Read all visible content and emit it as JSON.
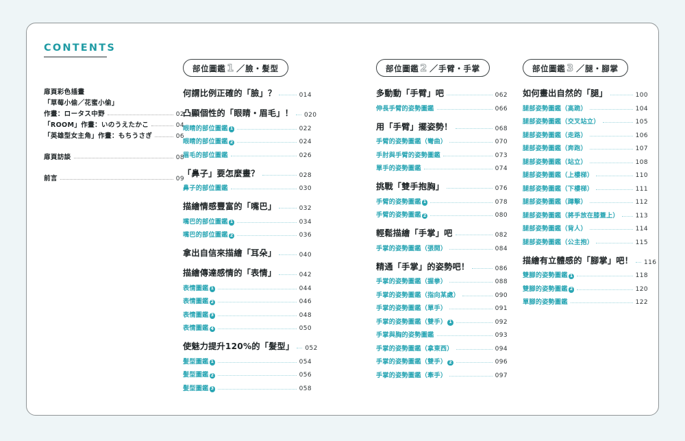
{
  "header": {
    "contents_label": "CONTENTS"
  },
  "front_matter": {
    "items": [
      {
        "label": "扉頁彩色插畫",
        "page": "",
        "dots": false
      },
      {
        "label": "「草莓小偷／花蜜小偷」",
        "page": "",
        "dots": false
      },
      {
        "label": "作畫：ロータス中野",
        "page": "02",
        "dots": true
      },
      {
        "label": "「ROOM」作畫：いのうえたかこ",
        "page": "04",
        "dots": true
      },
      {
        "label": "「英雄型女主角」作畫：もちうさぎ",
        "page": "06",
        "dots": true
      },
      {
        "label": "扉頁訪談",
        "page": "08",
        "dots": true,
        "gap": true
      },
      {
        "label": "前言",
        "page": "09",
        "dots": true,
        "gap": true
      }
    ]
  },
  "sections": [
    {
      "pill_prefix": "部位圖鑑",
      "pill_number": "1",
      "pill_slash": "／",
      "pill_suffix": "臉・髮型",
      "entries": [
        {
          "type": "main",
          "label": "何謂比例正確的「臉」？",
          "page": "014"
        },
        {
          "type": "main",
          "label": "凸顯個性的「眼睛・眉毛」！",
          "page": "020"
        },
        {
          "type": "sub",
          "label": "眼睛的部位圖鑑",
          "badge": "1",
          "page": "022"
        },
        {
          "type": "sub",
          "label": "眼睛的部位圖鑑",
          "badge": "2",
          "page": "024"
        },
        {
          "type": "sub",
          "label": "眉毛的部位圖鑑",
          "badge": "",
          "page": "026"
        },
        {
          "type": "main",
          "label": "「鼻子」要怎麼畫？",
          "page": "028"
        },
        {
          "type": "sub",
          "label": "鼻子的部位圖鑑",
          "badge": "",
          "page": "030"
        },
        {
          "type": "main",
          "label": "描繪情感豐富的「嘴巴」",
          "page": "032"
        },
        {
          "type": "sub",
          "label": "嘴巴的部位圖鑑",
          "badge": "1",
          "page": "034"
        },
        {
          "type": "sub",
          "label": "嘴巴的部位圖鑑",
          "badge": "2",
          "page": "036"
        },
        {
          "type": "main",
          "label": "拿出自信來描繪「耳朵」",
          "page": "040"
        },
        {
          "type": "main",
          "label": "描繪傳達感情的「表情」",
          "page": "042"
        },
        {
          "type": "sub",
          "label": "表情圖鑑",
          "badge": "1",
          "page": "044"
        },
        {
          "type": "sub",
          "label": "表情圖鑑",
          "badge": "2",
          "page": "046"
        },
        {
          "type": "sub",
          "label": "表情圖鑑",
          "badge": "3",
          "page": "048"
        },
        {
          "type": "sub",
          "label": "表情圖鑑",
          "badge": "4",
          "page": "050"
        },
        {
          "type": "main",
          "label": "使魅力提升120%的「髮型」",
          "page": "052"
        },
        {
          "type": "sub",
          "label": "髮型圖鑑",
          "badge": "1",
          "page": "054"
        },
        {
          "type": "sub",
          "label": "髮型圖鑑",
          "badge": "2",
          "page": "056"
        },
        {
          "type": "sub",
          "label": "髮型圖鑑",
          "badge": "3",
          "page": "058"
        }
      ]
    },
    {
      "pill_prefix": "部位圖鑑",
      "pill_number": "2",
      "pill_slash": "／",
      "pill_suffix": "手臂・手掌",
      "entries": [
        {
          "type": "main",
          "label": "多動動「手臂」吧",
          "page": "062"
        },
        {
          "type": "sub",
          "label": "伸長手臂的姿勢圖鑑",
          "badge": "",
          "page": "066"
        },
        {
          "type": "main",
          "label": "用「手臂」擺姿勢！",
          "page": "068"
        },
        {
          "type": "sub",
          "label": "手臂的姿勢圖鑑（彎曲）",
          "badge": "",
          "page": "070"
        },
        {
          "type": "sub",
          "label": "手肘與手臂的姿勢圖鑑",
          "badge": "",
          "page": "073"
        },
        {
          "type": "sub",
          "label": "單手的姿勢圖鑑",
          "badge": "",
          "page": "074"
        },
        {
          "type": "main",
          "label": "挑戰「雙手抱胸」",
          "page": "076"
        },
        {
          "type": "sub",
          "label": "手臂的姿勢圖鑑",
          "badge": "1",
          "page": "078"
        },
        {
          "type": "sub",
          "label": "手臂的姿勢圖鑑",
          "badge": "2",
          "page": "080"
        },
        {
          "type": "main",
          "label": "輕鬆描繪「手掌」吧",
          "page": "082"
        },
        {
          "type": "sub",
          "label": "手掌的姿勢圖鑑（張開）",
          "badge": "",
          "page": "084"
        },
        {
          "type": "main",
          "label": "精通「手掌」的姿勢吧！",
          "page": "086"
        },
        {
          "type": "sub",
          "label": "手掌的姿勢圖鑑（握拳）",
          "badge": "",
          "page": "088"
        },
        {
          "type": "sub",
          "label": "手掌的姿勢圖鑑（指向某處）",
          "badge": "",
          "page": "090"
        },
        {
          "type": "sub",
          "label": "手掌的姿勢圖鑑（單手）",
          "badge": "",
          "page": "091"
        },
        {
          "type": "sub",
          "label": "手掌的姿勢圖鑑（雙手）",
          "badge": "1",
          "page": "092"
        },
        {
          "type": "sub",
          "label": "手掌與胸的姿勢圖鑑",
          "badge": "",
          "page": "093"
        },
        {
          "type": "sub",
          "label": "手掌的姿勢圖鑑（拿東西）",
          "badge": "",
          "page": "094"
        },
        {
          "type": "sub",
          "label": "手掌的姿勢圖鑑（雙手）",
          "badge": "2",
          "page": "096"
        },
        {
          "type": "sub",
          "label": "手掌的姿勢圖鑑（牽手）",
          "badge": "",
          "page": "097"
        }
      ]
    },
    {
      "pill_prefix": "部位圖鑑",
      "pill_number": "3",
      "pill_slash": "／",
      "pill_suffix": "腿・腳掌",
      "entries": [
        {
          "type": "main",
          "label": "如何畫出自然的「腿」",
          "page": "100"
        },
        {
          "type": "sub",
          "label": "腿部姿勢圖鑑（高跪）",
          "badge": "",
          "page": "104"
        },
        {
          "type": "sub",
          "label": "腿部姿勢圖鑑（交叉站立）",
          "badge": "",
          "page": "105"
        },
        {
          "type": "sub",
          "label": "腿部姿勢圖鑑（走路）",
          "badge": "",
          "page": "106"
        },
        {
          "type": "sub",
          "label": "腿部姿勢圖鑑（奔跑）",
          "badge": "",
          "page": "107"
        },
        {
          "type": "sub",
          "label": "腿部姿勢圖鑑（站立）",
          "badge": "",
          "page": "108"
        },
        {
          "type": "sub",
          "label": "腿部姿勢圖鑑（上樓梯）",
          "badge": "",
          "page": "110"
        },
        {
          "type": "sub",
          "label": "腿部姿勢圖鑑（下樓梯）",
          "badge": "",
          "page": "111"
        },
        {
          "type": "sub",
          "label": "腿部姿勢圖鑑（蹲擊）",
          "badge": "",
          "page": "112"
        },
        {
          "type": "sub",
          "label": "腿部姿勢圖鑑（將手放在膝蓋上）",
          "badge": "",
          "page": "113"
        },
        {
          "type": "sub",
          "label": "腿部姿勢圖鑑（背人）",
          "badge": "",
          "page": "114"
        },
        {
          "type": "sub",
          "label": "腿部姿勢圖鑑（公主抱）",
          "badge": "",
          "page": "115"
        },
        {
          "type": "main",
          "label": "描繪有立體感的「腳掌」吧！",
          "page": "116"
        },
        {
          "type": "sub",
          "label": "雙腳的姿勢圖鑑",
          "badge": "1",
          "page": "118"
        },
        {
          "type": "sub",
          "label": "雙腳的姿勢圖鑑",
          "badge": "2",
          "page": "120"
        },
        {
          "type": "sub",
          "label": "單腳的姿勢圖鑑",
          "badge": "",
          "page": "122"
        }
      ]
    }
  ],
  "colors": {
    "accent_teal": "#2aa6b4",
    "heading_teal": "#1f9ba4",
    "dot_leader": "#9ed6de",
    "text_dark": "#1d2325",
    "page_bg": "#eef5f7",
    "card_bg": "#ffffff",
    "card_border": "#8f9496"
  }
}
